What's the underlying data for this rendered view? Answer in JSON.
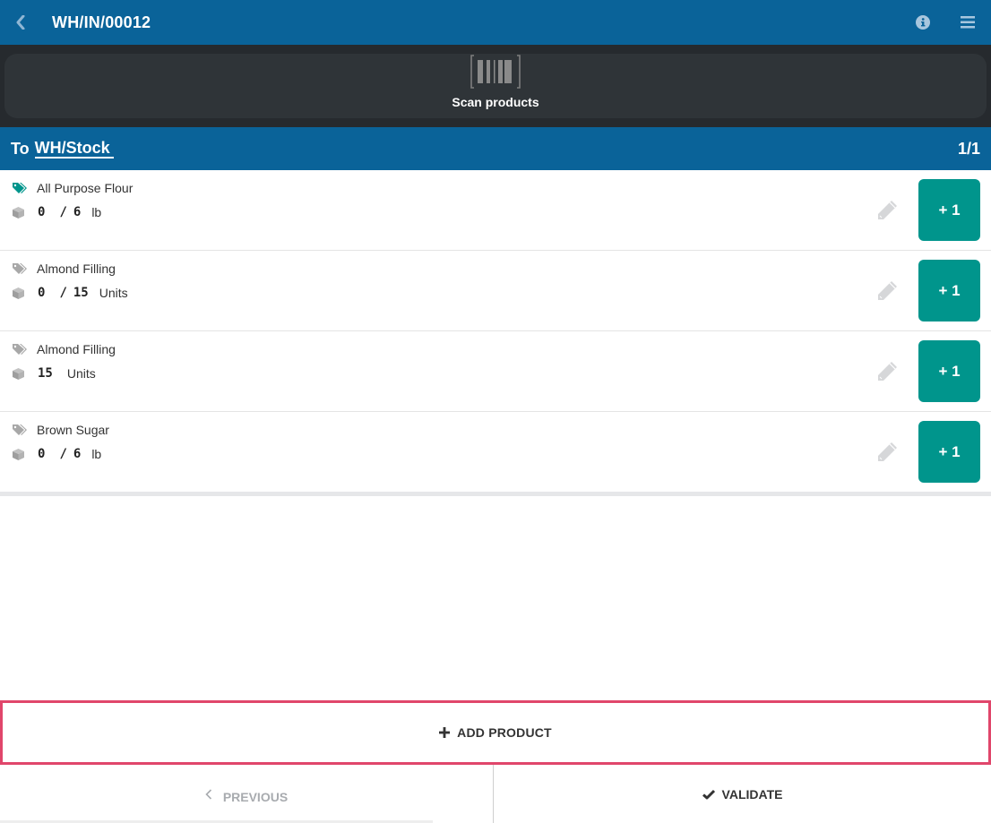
{
  "header": {
    "title": "WH/IN/00012",
    "back_icon": "chevron-left-icon",
    "info_icon": "info-icon",
    "menu_icon": "hamburger-menu-icon"
  },
  "scanner": {
    "label": "Scan products",
    "icon": "barcode-icon"
  },
  "location": {
    "prefix": "To",
    "name": "WH/Stock",
    "page_counter": "1/1"
  },
  "lines": [
    {
      "product": "All Purpose Flour",
      "qty_done": "0",
      "separator": "/",
      "qty_total": "6",
      "uom": "lb",
      "tag_color": "#00958c",
      "increment_label": "+ 1"
    },
    {
      "product": "Almond Filling",
      "qty_done": "0",
      "separator": "/",
      "qty_total": "15",
      "uom": "Units",
      "tag_color": "#a8a8a8",
      "increment_label": "+ 1"
    },
    {
      "product": "Almond Filling",
      "qty_done": "15",
      "uom": "Units",
      "tag_color": "#a8a8a8",
      "increment_label": "+ 1"
    },
    {
      "product": "Brown Sugar",
      "qty_done": "0",
      "separator": "/",
      "qty_total": "6",
      "uom": "lb",
      "tag_color": "#a8a8a8",
      "increment_label": "+ 1"
    }
  ],
  "actions": {
    "add_product": "ADD PRODUCT",
    "previous": "PREVIOUS",
    "validate": "VALIDATE"
  },
  "colors": {
    "header_blue": "#0a6399",
    "scanner_dark": "#262a2e",
    "accent_teal": "#00958c",
    "highlight_border": "#e0466b"
  }
}
